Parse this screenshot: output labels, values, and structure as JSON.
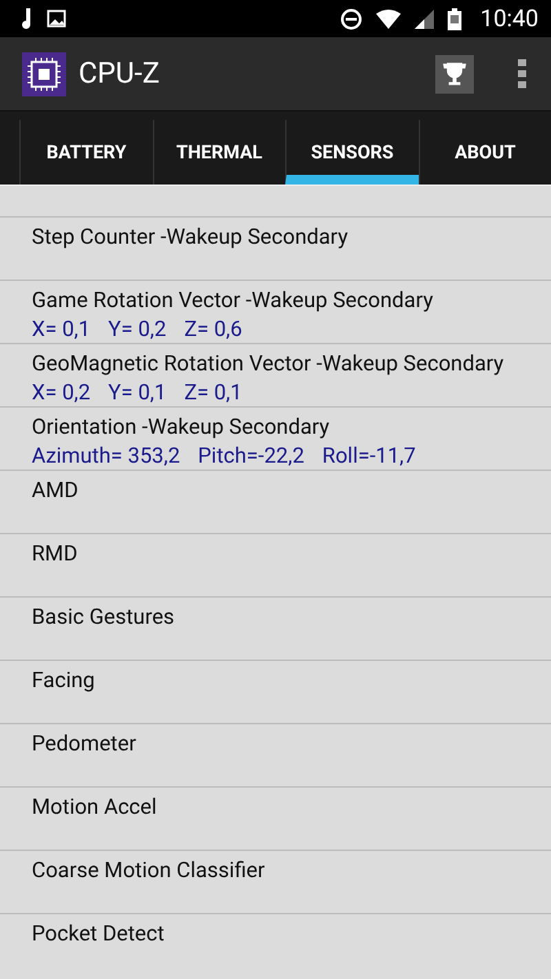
{
  "status_bar": {
    "time": "10:40"
  },
  "app_bar": {
    "title": "CPU-Z"
  },
  "tabs": [
    {
      "label": "BATTERY",
      "selected": false
    },
    {
      "label": "THERMAL",
      "selected": false
    },
    {
      "label": "SENSORS",
      "selected": true
    },
    {
      "label": "ABOUT",
      "selected": false
    }
  ],
  "sensors": [
    {
      "name": "Step Counter -Wakeup Secondary"
    },
    {
      "name": "Game Rotation Vector -Wakeup Secondary",
      "readings": [
        "X= 0,1",
        "Y= 0,2",
        "Z= 0,6"
      ]
    },
    {
      "name": "GeoMagnetic Rotation Vector -Wakeup Secondary",
      "readings": [
        "X= 0,2",
        "Y= 0,1",
        "Z= 0,1"
      ]
    },
    {
      "name": "Orientation -Wakeup Secondary",
      "readings": [
        "Azimuth= 353,2",
        "Pitch=-22,2",
        "Roll=-11,7"
      ]
    },
    {
      "name": "AMD"
    },
    {
      "name": "RMD"
    },
    {
      "name": "Basic Gestures"
    },
    {
      "name": "Facing"
    },
    {
      "name": "Pedometer"
    },
    {
      "name": "Motion Accel"
    },
    {
      "name": "Coarse Motion Classifier"
    },
    {
      "name": "Pocket Detect"
    }
  ]
}
